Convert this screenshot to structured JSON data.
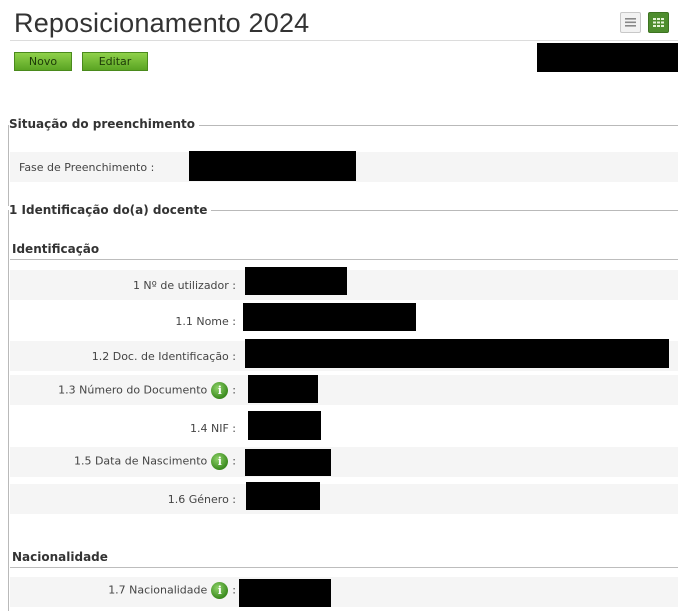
{
  "page": {
    "title": "Reposicionamento 2024"
  },
  "toolbar": {
    "novo_label": "Novo",
    "editar_label": "Editar",
    "view_list_icon": "list-view-icon",
    "view_grid_icon": "grid-view-icon"
  },
  "sections": {
    "situacao": {
      "legend": "Situação do preenchimento",
      "fase_label": "Fase de Preenchimento :"
    },
    "identificacao_docente": {
      "legend": "1 Identificação do(a) docente",
      "subheading": "Identificação",
      "fields": [
        {
          "label": "1 Nº de utilizador :"
        },
        {
          "label": "1.1 Nome :"
        },
        {
          "label": "1.2 Doc. de Identificação :"
        },
        {
          "label": "1.3 Número do Documento",
          "suffix": ":"
        },
        {
          "label": "1.4 NIF :"
        },
        {
          "label": "1.5 Data de Nascimento",
          "suffix": ":"
        },
        {
          "label": "1.6 Género :"
        }
      ]
    },
    "nacionalidade": {
      "subheading": "Nacionalidade",
      "fields": [
        {
          "label": "1.7 Nacionalidade",
          "suffix": ":"
        }
      ]
    }
  },
  "colors": {
    "button_green": "#6cb22f",
    "info_green": "#3b8b1f",
    "redaction": "#000000"
  }
}
